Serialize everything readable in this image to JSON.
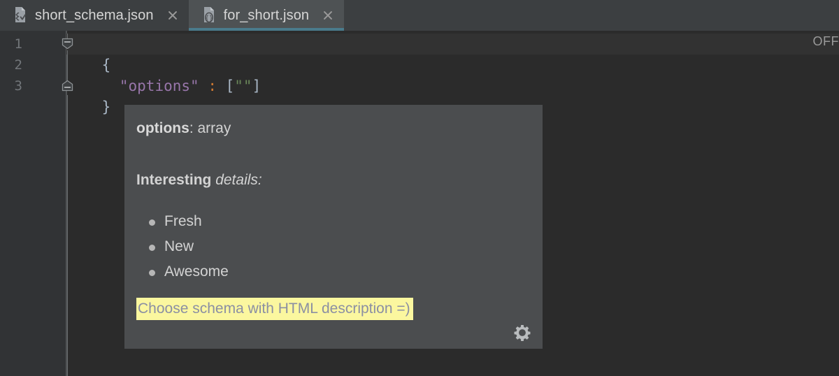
{
  "window": {
    "background_color": "#2b2b2b"
  },
  "tabs": [
    {
      "label": "short_schema.json",
      "icon": "json-schema-file-icon",
      "active": false,
      "close_icon": "close-icon"
    },
    {
      "label": "for_short.json",
      "icon": "json-file-icon",
      "active": true,
      "close_icon": "close-icon"
    }
  ],
  "editor": {
    "status_label": "OFF",
    "line_numbers": [
      "1",
      "2",
      "3"
    ],
    "lines": [
      {
        "num": "1",
        "text": "{",
        "fold": "collapse-down"
      },
      {
        "num": "2",
        "indent": "  ",
        "key": "\"options\"",
        "colon": " : ",
        "open_bracket": "[",
        "string": "\"\"",
        "close_bracket": "]"
      },
      {
        "num": "3",
        "text": "}",
        "fold": "collapse-up"
      }
    ],
    "colors": {
      "property_key": "#9876aa",
      "colon": "#cc7832",
      "string": "#6a8759",
      "punctuation": "#a9b7c6",
      "background": "#2b2b2b",
      "gutter": "#313335"
    }
  },
  "doc_popup": {
    "title_name": "options",
    "title_type": ": array",
    "section_bold": "Interesting",
    "section_italic": "details:",
    "bullets": [
      "Fresh",
      "New",
      "Awesome"
    ],
    "link_text": "Choose schema with HTML description =)",
    "link_highlight_color": "#fbf79f",
    "link_text_color": "#8b8fa3",
    "background_color": "#4b4d4f",
    "settings_icon": "gear-icon"
  }
}
